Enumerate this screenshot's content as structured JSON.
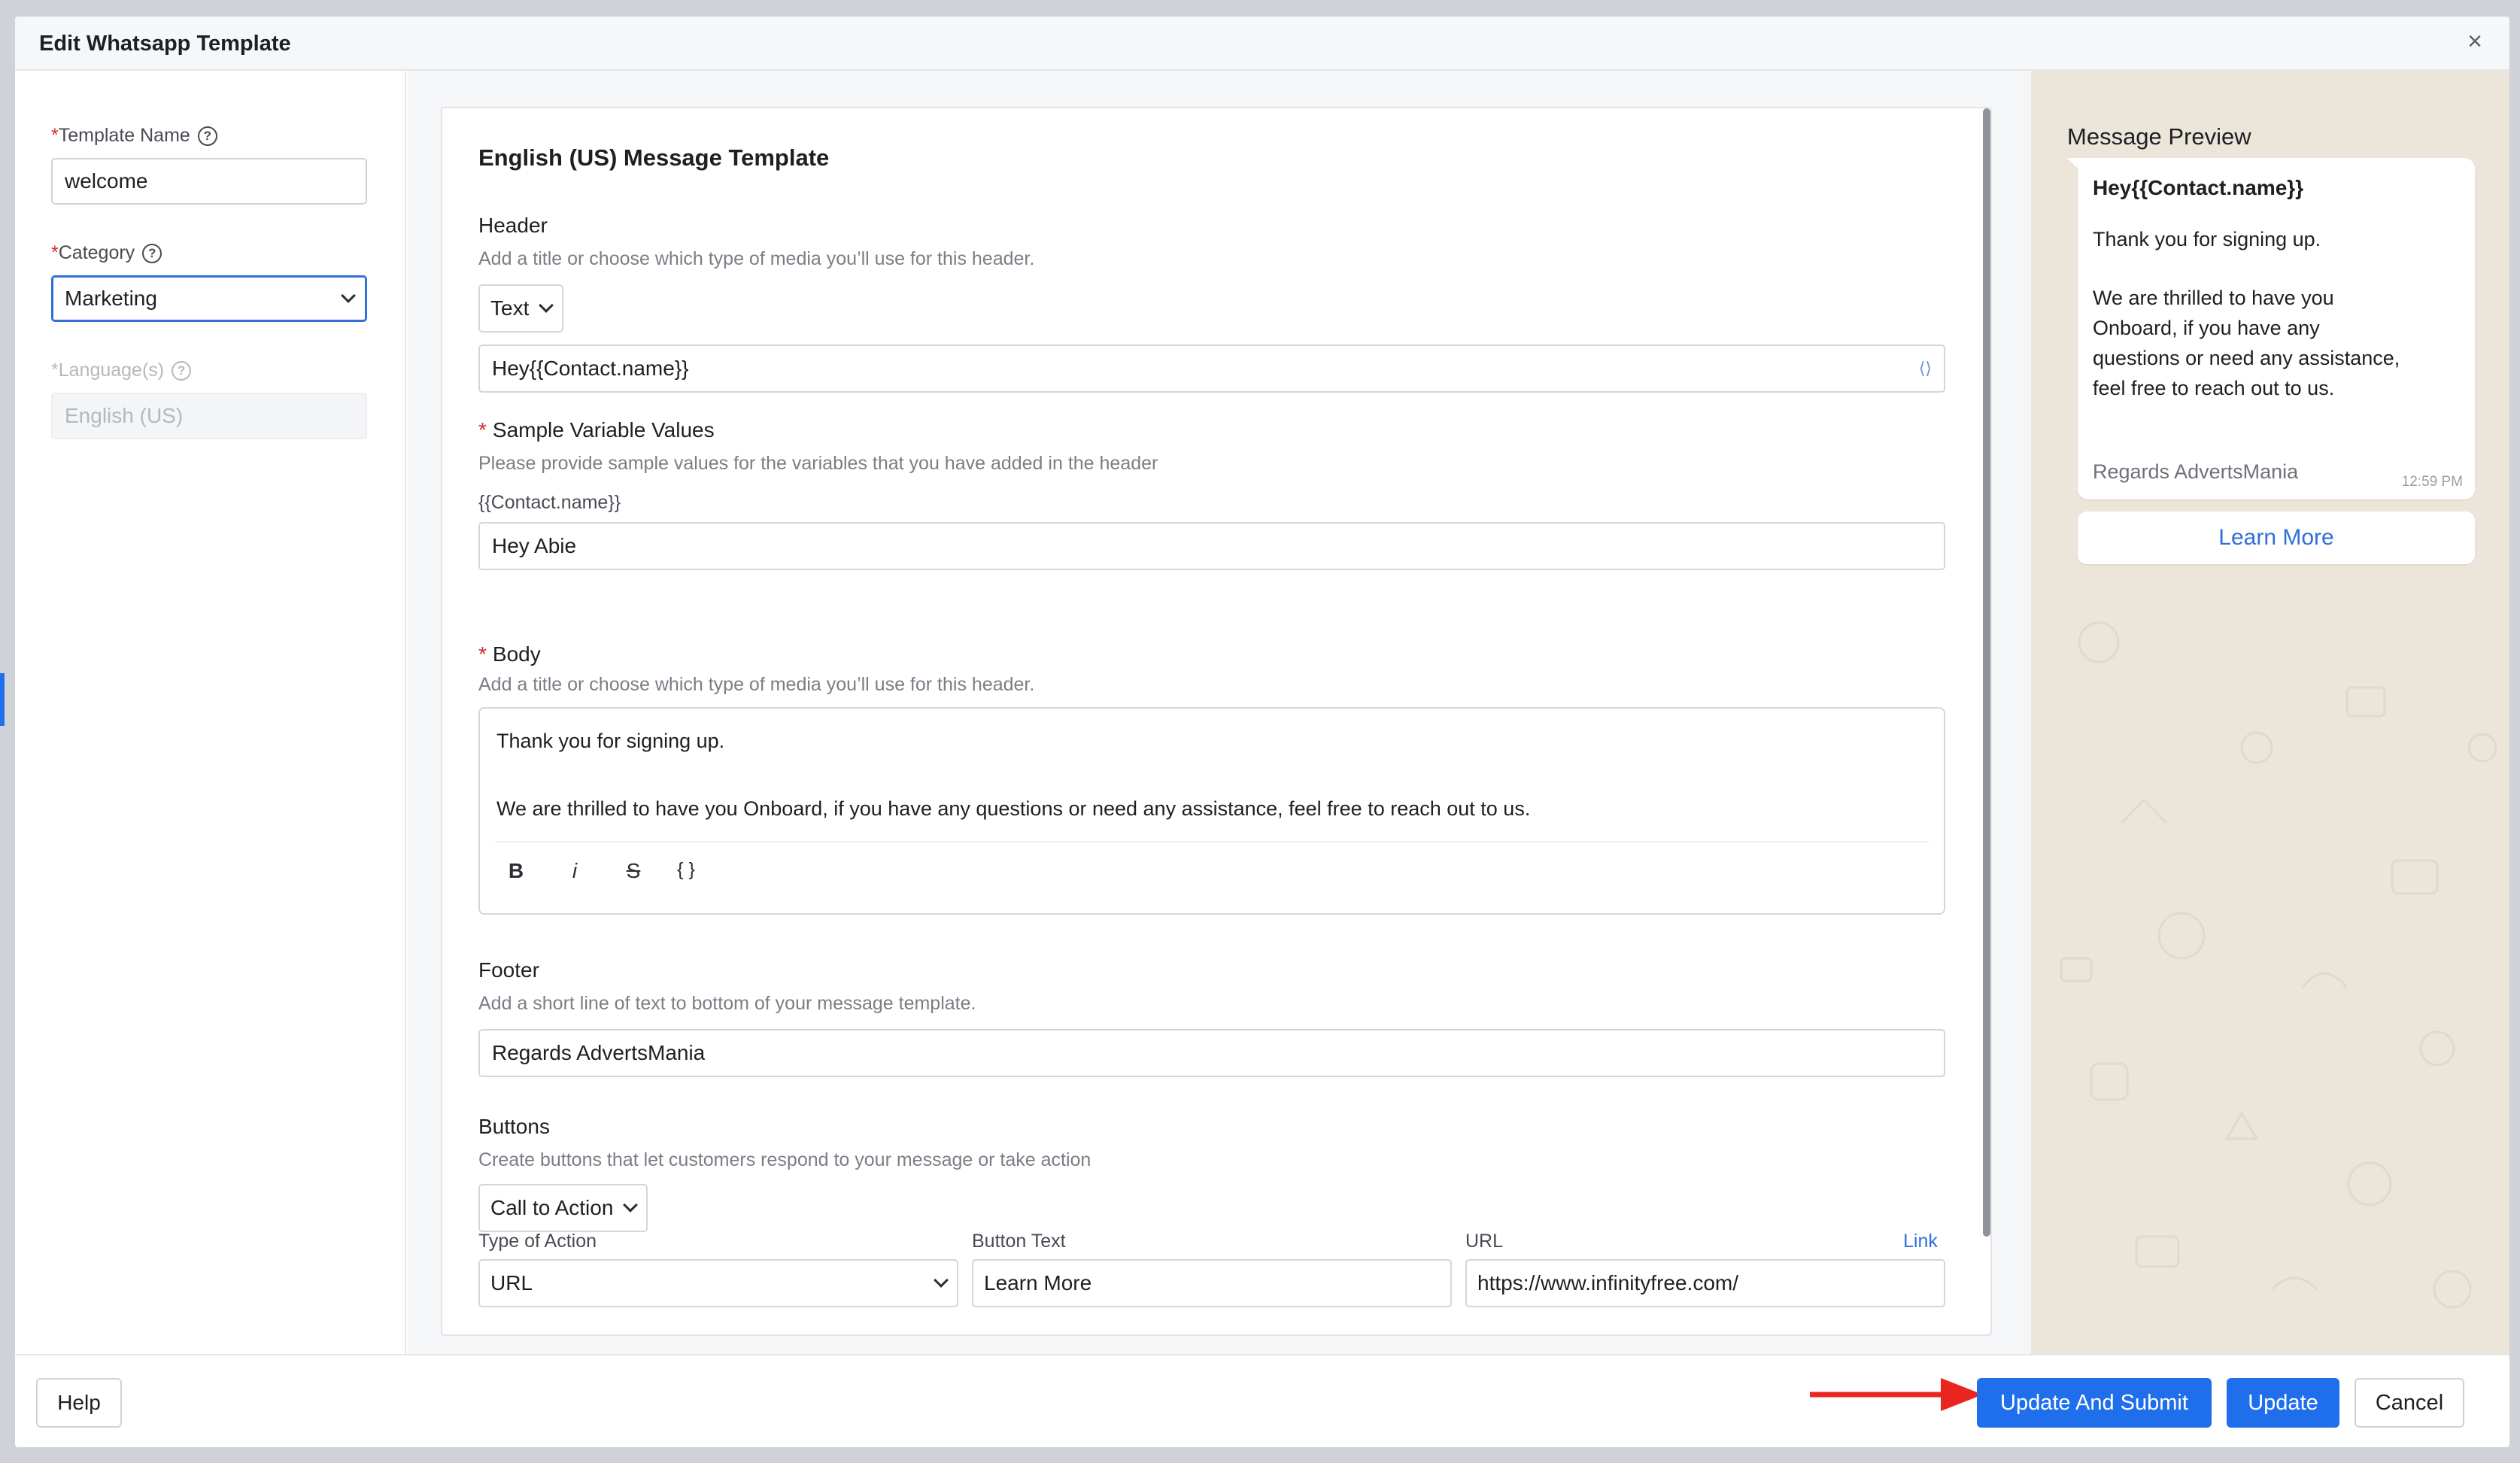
{
  "modal": {
    "title": "Edit Whatsapp Template",
    "close_glyph": "×"
  },
  "sidebar": {
    "template_name": {
      "required": "*",
      "label": "Template Name",
      "value": "welcome"
    },
    "category": {
      "required": "*",
      "label": "Category",
      "value": "Marketing"
    },
    "language": {
      "required": "*",
      "label": "Language(s)",
      "value": "English (US)"
    },
    "help_glyph": "?"
  },
  "editor": {
    "card_title": "English (US) Message Template",
    "header": {
      "title": "Header",
      "description": "Add a title or choose which type of media you’ll use for this header.",
      "type": "Text",
      "value": "Hey{{Contact.name}}",
      "var_icon": "⟨⟩"
    },
    "sample": {
      "required": "*",
      "title": "Sample Variable Values",
      "description": "Please provide sample values for the variables that you have added in the header",
      "variable": "{{Contact.name}}",
      "value": "Hey Abie"
    },
    "body": {
      "required": "*",
      "title": "Body",
      "description": "Add a title or choose which type of media you’ll use for this header.",
      "line1": "Thank you for signing up.",
      "line2": "We are thrilled to have you Onboard, if you have any questions or need any assistance, feel free to reach out to us.",
      "format": {
        "bold": "B",
        "italic": "i",
        "strike": "S",
        "variable": "{ }"
      }
    },
    "footer": {
      "title": "Footer",
      "description": "Add a short line of text to bottom of your message template.",
      "value": "Regards AdvertsMania"
    },
    "buttons": {
      "title": "Buttons",
      "description": "Create buttons that let customers respond to your message or take action",
      "type": "Call to Action",
      "type_of_action_label": "Type of Action",
      "type_of_action_value": "URL",
      "button_text_label": "Button Text",
      "button_text_value": "Learn More",
      "url_label": "URL",
      "url_value": "https://www.infinityfree.com/",
      "link_label": "Link"
    }
  },
  "preview": {
    "title": "Message Preview",
    "header": "Hey{{Contact.name}}",
    "line1": "Thank you for signing up.",
    "line2": "We are thrilled to have you Onboard, if you have any questions or need any assistance, feel free to reach out to us.",
    "footer": "Regards AdvertsMania",
    "time": "12:59 PM",
    "button": "Learn More"
  },
  "footer_bar": {
    "help": "Help",
    "update_and_submit": "Update And Submit",
    "update": "Update",
    "cancel": "Cancel"
  },
  "colors": {
    "accent": "#1f6fec",
    "required": "#d52b2b",
    "arrow": "#e8261f",
    "preview_bg": "#ece5da"
  }
}
